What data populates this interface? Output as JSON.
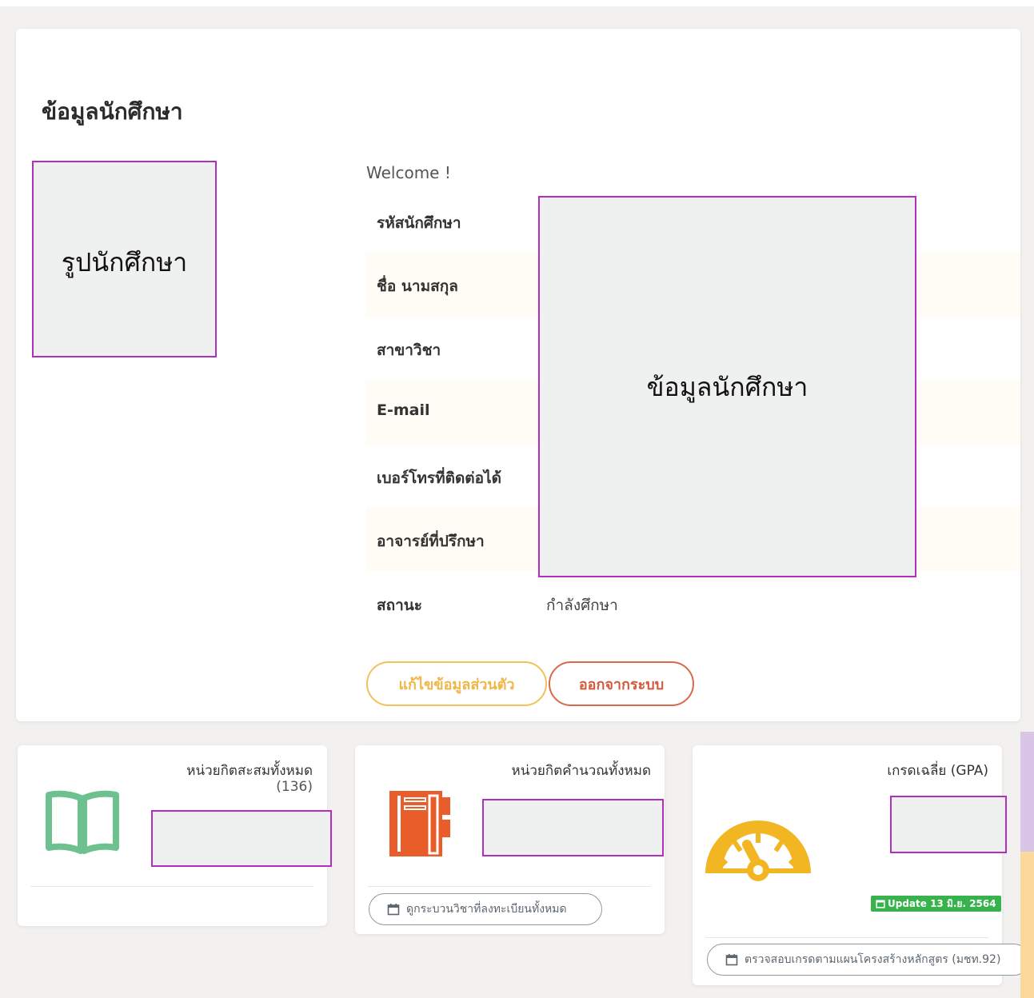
{
  "page": {
    "title": "ข้อมูลนักศึกษา",
    "photo_label": "รูปนักศึกษา",
    "info_redact_label": "ข้อมูลนักศึกษา"
  },
  "profile": {
    "welcome": "Welcome !",
    "fields": [
      {
        "label": "รหัสนักศึกษา",
        "value": ""
      },
      {
        "label": "ชื่อ นามสกุล",
        "value": ""
      },
      {
        "label": "สาขาวิชา",
        "value": ""
      },
      {
        "label": "E-mail",
        "value": ""
      },
      {
        "label": "เบอร์โทรที่ติดต่อได้",
        "value": ""
      },
      {
        "label": "อาจารย์ที่ปรึกษา",
        "value": ""
      },
      {
        "label": "สถานะ",
        "value": "กำลังศึกษา"
      }
    ],
    "edit_button": "แก้ไขข้อมูลส่วนตัว",
    "logout_button": "ออกจากระบบ"
  },
  "stats": [
    {
      "title": "หน่วยกิตสะสมทั้งหมด",
      "subtitle": "(136)",
      "icon": "book-icon",
      "color": "#6cc18f"
    },
    {
      "title": "หน่วยกิตคำนวณทั้งหมด",
      "icon": "notebook-icon",
      "color": "#e85d2a",
      "button": "ดูกระบวนวิชาที่ลงทะเบียนทั้งหมด"
    },
    {
      "title": "เกรดเฉลี่ย (GPA)",
      "icon": "gauge-icon",
      "color": "#f2b623",
      "badge": "Update 13 มิ.ย. 2564",
      "button": "ตรวจสอบเกรดตามแผนโครงสร้างหลักสูตร (มชท.92)"
    }
  ]
}
